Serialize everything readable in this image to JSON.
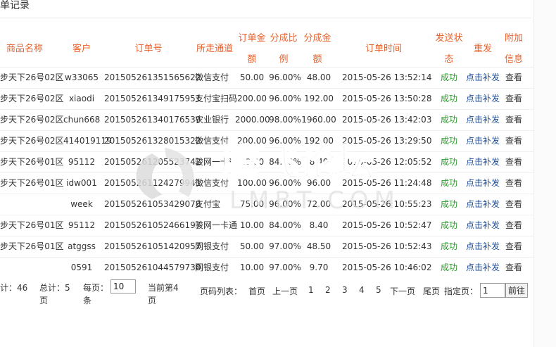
{
  "panel": {
    "title": "单记录"
  },
  "headers": {
    "product": "商品名称",
    "customer": "客户",
    "order_no": "订单号",
    "channel": "所走通道",
    "amount_l1": "订单金",
    "amount_l2": "额",
    "ratio_l1": "分成比",
    "ratio_l2": "例",
    "share_l1": "分成金",
    "share_l2": "额",
    "time": "订单时间",
    "status_l1": "发送状",
    "status_l2": "态",
    "resend": "重发",
    "extra_l1": "附加",
    "extra_l2": "信息"
  },
  "rows": [
    {
      "product": "步天下26号02区",
      "customer": "w33065",
      "order_no": "201505261351565622",
      "channel": "微信支付",
      "amount": "50.00",
      "ratio": "96.00%",
      "share": "48.00",
      "time": "2015-05-26 13:52:14",
      "status": "成功",
      "resend": "点击补发",
      "view": "查看"
    },
    {
      "product": "步天下26号02区",
      "customer": "xiaodi",
      "order_no": "201505261349175951",
      "channel": "支付宝扫码",
      "amount": "200.00",
      "ratio": "96.00%",
      "share": "192.00",
      "time": "2015-05-26 13:50:28",
      "status": "成功",
      "resend": "点击补发",
      "view": "查看"
    },
    {
      "product": "步天下26号02区",
      "customer": "chun668",
      "order_no": "201505261340176539",
      "channel": "农业银行",
      "amount": "2000.00",
      "ratio": "98.00%",
      "share": "1960.00",
      "time": "2015-05-26 13:42:03",
      "status": "成功",
      "resend": "点击补发",
      "view": "查看"
    },
    {
      "product": "步天下26号02区",
      "customer": "414019119",
      "order_no": "201505261328015322",
      "channel": "微信支付",
      "amount": "200.00",
      "ratio": "96.00%",
      "share": "192.00",
      "time": "2015-05-26 13:29:50",
      "status": "成功",
      "resend": "点击补发",
      "view": "查看"
    },
    {
      "product": "步天下26号01区",
      "customer": "95112",
      "order_no": "201505261205523742",
      "channel": "骏网一卡通",
      "amount": "10.00",
      "ratio": "84.00%",
      "share": "8.40",
      "time": "2015-05-26 12:05:52",
      "status": "成功",
      "resend": "点击补发",
      "view": "查看"
    },
    {
      "product": "步天下26号01区",
      "customer": "idw001",
      "order_no": "201505261124279941",
      "channel": "微信支付",
      "amount": "100.00",
      "ratio": "96.00%",
      "share": "96.00",
      "time": "2015-05-26 11:24:48",
      "status": "成功",
      "resend": "点击补发",
      "view": "查看"
    },
    {
      "product": "",
      "customer": "week",
      "order_no": "201505261053429078",
      "channel": "支付宝",
      "amount": "75.00",
      "ratio": "96.00%",
      "share": "72.00",
      "time": "2015-05-26 10:55:23",
      "status": "成功",
      "resend": "点击补发",
      "view": "查看"
    },
    {
      "product": "步天下26号01区",
      "customer": "95112",
      "order_no": "201505261052466197",
      "channel": "骏网一卡通",
      "amount": "10.00",
      "ratio": "84.00%",
      "share": "8.40",
      "time": "2015-05-26 10:52:47",
      "status": "成功",
      "resend": "点击补发",
      "view": "查看"
    },
    {
      "product": "步天下26号01区",
      "customer": "atggss",
      "order_no": "201505261051420957",
      "channel": "网银支付",
      "amount": "50.00",
      "ratio": "97.00%",
      "share": "48.50",
      "time": "2015-05-26 10:52:43",
      "status": "成功",
      "resend": "点击补发",
      "view": "查看"
    },
    {
      "product": "",
      "customer": "0591",
      "order_no": "201505261044579730",
      "channel": "网银支付",
      "amount": "10.00",
      "ratio": "97.00%",
      "share": "9.70",
      "time": "2015-05-26 10:46:02",
      "status": "成功",
      "resend": "点击补发",
      "view": "查看"
    }
  ],
  "footer": {
    "total_records_label": "计：46",
    "total_pages_l1": "总计：5",
    "total_pages_l2": "页",
    "per_page_l1": "每页：",
    "per_page_l2": "条",
    "per_page_value": "10",
    "current_page_l1": "当前第4",
    "current_page_l2": "页",
    "page_list_label": "页码列表：",
    "first": "首页",
    "prev": "上一页",
    "pages": [
      "1",
      "2",
      "3",
      "4",
      "5"
    ],
    "next": "下一页",
    "last": "尾页",
    "goto_label": "指定页：",
    "goto_value": "1",
    "go_button": "前往"
  },
  "watermark": {
    "cn": "腾飞论坛",
    "en": "LMBT.COM"
  },
  "colors": {
    "header": "#e8612c",
    "status": "#2e9a2e",
    "resend": "#1a4d99"
  }
}
